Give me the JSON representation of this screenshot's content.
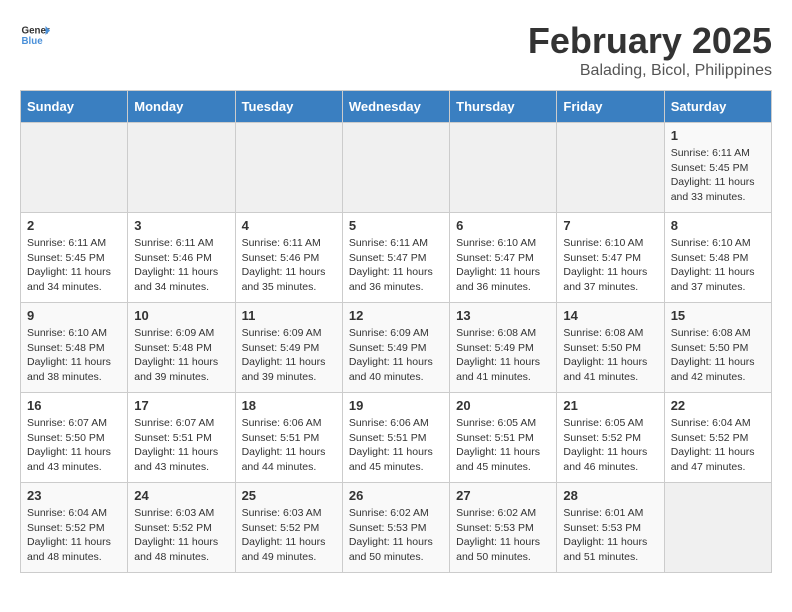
{
  "header": {
    "logo_general": "General",
    "logo_blue": "Blue",
    "month_title": "February 2025",
    "location": "Balading, Bicol, Philippines"
  },
  "days_of_week": [
    "Sunday",
    "Monday",
    "Tuesday",
    "Wednesday",
    "Thursday",
    "Friday",
    "Saturday"
  ],
  "weeks": [
    [
      {
        "day": "",
        "info": ""
      },
      {
        "day": "",
        "info": ""
      },
      {
        "day": "",
        "info": ""
      },
      {
        "day": "",
        "info": ""
      },
      {
        "day": "",
        "info": ""
      },
      {
        "day": "",
        "info": ""
      },
      {
        "day": "1",
        "info": "Sunrise: 6:11 AM\nSunset: 5:45 PM\nDaylight: 11 hours and 33 minutes."
      }
    ],
    [
      {
        "day": "2",
        "info": "Sunrise: 6:11 AM\nSunset: 5:45 PM\nDaylight: 11 hours and 34 minutes."
      },
      {
        "day": "3",
        "info": "Sunrise: 6:11 AM\nSunset: 5:46 PM\nDaylight: 11 hours and 34 minutes."
      },
      {
        "day": "4",
        "info": "Sunrise: 6:11 AM\nSunset: 5:46 PM\nDaylight: 11 hours and 35 minutes."
      },
      {
        "day": "5",
        "info": "Sunrise: 6:11 AM\nSunset: 5:47 PM\nDaylight: 11 hours and 36 minutes."
      },
      {
        "day": "6",
        "info": "Sunrise: 6:10 AM\nSunset: 5:47 PM\nDaylight: 11 hours and 36 minutes."
      },
      {
        "day": "7",
        "info": "Sunrise: 6:10 AM\nSunset: 5:47 PM\nDaylight: 11 hours and 37 minutes."
      },
      {
        "day": "8",
        "info": "Sunrise: 6:10 AM\nSunset: 5:48 PM\nDaylight: 11 hours and 37 minutes."
      }
    ],
    [
      {
        "day": "9",
        "info": "Sunrise: 6:10 AM\nSunset: 5:48 PM\nDaylight: 11 hours and 38 minutes."
      },
      {
        "day": "10",
        "info": "Sunrise: 6:09 AM\nSunset: 5:48 PM\nDaylight: 11 hours and 39 minutes."
      },
      {
        "day": "11",
        "info": "Sunrise: 6:09 AM\nSunset: 5:49 PM\nDaylight: 11 hours and 39 minutes."
      },
      {
        "day": "12",
        "info": "Sunrise: 6:09 AM\nSunset: 5:49 PM\nDaylight: 11 hours and 40 minutes."
      },
      {
        "day": "13",
        "info": "Sunrise: 6:08 AM\nSunset: 5:49 PM\nDaylight: 11 hours and 41 minutes."
      },
      {
        "day": "14",
        "info": "Sunrise: 6:08 AM\nSunset: 5:50 PM\nDaylight: 11 hours and 41 minutes."
      },
      {
        "day": "15",
        "info": "Sunrise: 6:08 AM\nSunset: 5:50 PM\nDaylight: 11 hours and 42 minutes."
      }
    ],
    [
      {
        "day": "16",
        "info": "Sunrise: 6:07 AM\nSunset: 5:50 PM\nDaylight: 11 hours and 43 minutes."
      },
      {
        "day": "17",
        "info": "Sunrise: 6:07 AM\nSunset: 5:51 PM\nDaylight: 11 hours and 43 minutes."
      },
      {
        "day": "18",
        "info": "Sunrise: 6:06 AM\nSunset: 5:51 PM\nDaylight: 11 hours and 44 minutes."
      },
      {
        "day": "19",
        "info": "Sunrise: 6:06 AM\nSunset: 5:51 PM\nDaylight: 11 hours and 45 minutes."
      },
      {
        "day": "20",
        "info": "Sunrise: 6:05 AM\nSunset: 5:51 PM\nDaylight: 11 hours and 45 minutes."
      },
      {
        "day": "21",
        "info": "Sunrise: 6:05 AM\nSunset: 5:52 PM\nDaylight: 11 hours and 46 minutes."
      },
      {
        "day": "22",
        "info": "Sunrise: 6:04 AM\nSunset: 5:52 PM\nDaylight: 11 hours and 47 minutes."
      }
    ],
    [
      {
        "day": "23",
        "info": "Sunrise: 6:04 AM\nSunset: 5:52 PM\nDaylight: 11 hours and 48 minutes."
      },
      {
        "day": "24",
        "info": "Sunrise: 6:03 AM\nSunset: 5:52 PM\nDaylight: 11 hours and 48 minutes."
      },
      {
        "day": "25",
        "info": "Sunrise: 6:03 AM\nSunset: 5:52 PM\nDaylight: 11 hours and 49 minutes."
      },
      {
        "day": "26",
        "info": "Sunrise: 6:02 AM\nSunset: 5:53 PM\nDaylight: 11 hours and 50 minutes."
      },
      {
        "day": "27",
        "info": "Sunrise: 6:02 AM\nSunset: 5:53 PM\nDaylight: 11 hours and 50 minutes."
      },
      {
        "day": "28",
        "info": "Sunrise: 6:01 AM\nSunset: 5:53 PM\nDaylight: 11 hours and 51 minutes."
      },
      {
        "day": "",
        "info": ""
      }
    ]
  ]
}
